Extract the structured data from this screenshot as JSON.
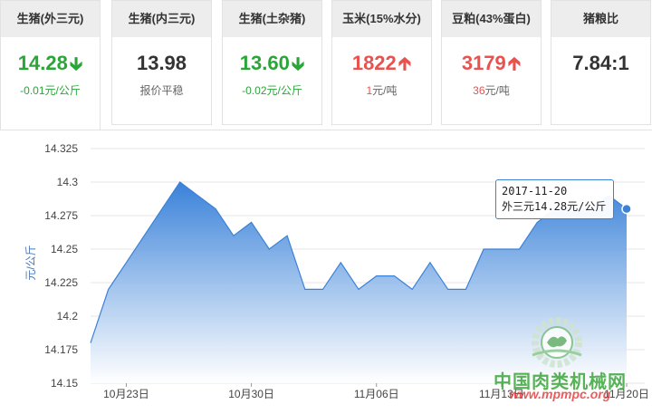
{
  "cards": [
    {
      "name": "生猪(外三元)",
      "value": "14.28",
      "trend": "down",
      "change": "-0.01元/公斤"
    },
    {
      "name": "生猪(内三元)",
      "value": "13.98",
      "trend": "none",
      "change": "报价平稳"
    },
    {
      "name": "生猪(土杂猪)",
      "value": "13.60",
      "trend": "down",
      "change": "-0.02元/公斤"
    },
    {
      "name": "玉米(15%水分)",
      "value": "1822",
      "trend": "up",
      "change_num": "1",
      "change_unit": "元/吨"
    },
    {
      "name": "豆粕(43%蛋白)",
      "value": "3179",
      "trend": "up",
      "change_num": "36",
      "change_unit": "元/吨"
    },
    {
      "name": "猪粮比",
      "value": "7.84:1",
      "trend": "none",
      "change": ""
    }
  ],
  "colors": {
    "up": "#e8524f",
    "down": "#2aa639",
    "line": "#3b82d6",
    "fill_top": "#2f7bd7",
    "fill_bottom": "#ffffff"
  },
  "tooltip": {
    "date": "2017-11-20",
    "label": "外三元14.28元/公斤"
  },
  "watermark": {
    "text": "中国肉类机械网",
    "url": "www.mpmpc.org",
    "logo": "gear-logo"
  },
  "chart_data": {
    "type": "area",
    "ylabel": "元/公斤",
    "ylim": [
      14.15,
      14.325
    ],
    "yticks": [
      "14.325",
      "14.3",
      "14.275",
      "14.25",
      "14.225",
      "14.2",
      "14.175",
      "14.15"
    ],
    "xlabels": [
      "10月23日",
      "10月30日",
      "11月06日",
      "11月13日",
      "11月20日"
    ],
    "grid": true,
    "series": [
      {
        "name": "外三元",
        "x": [
          "2017-10-21",
          "2017-10-22",
          "2017-10-23",
          "2017-10-24",
          "2017-10-25",
          "2017-10-26",
          "2017-10-27",
          "2017-10-28",
          "2017-10-29",
          "2017-10-30",
          "2017-10-31",
          "2017-11-01",
          "2017-11-02",
          "2017-11-03",
          "2017-11-04",
          "2017-11-05",
          "2017-11-06",
          "2017-11-07",
          "2017-11-08",
          "2017-11-09",
          "2017-11-10",
          "2017-11-11",
          "2017-11-12",
          "2017-11-13",
          "2017-11-14",
          "2017-11-15",
          "2017-11-16",
          "2017-11-17",
          "2017-11-18",
          "2017-11-19",
          "2017-11-20"
        ],
        "values": [
          14.18,
          14.22,
          14.24,
          14.26,
          14.28,
          14.3,
          14.29,
          14.28,
          14.26,
          14.27,
          14.25,
          14.26,
          14.22,
          14.22,
          14.24,
          14.22,
          14.23,
          14.23,
          14.22,
          14.24,
          14.22,
          14.22,
          14.25,
          14.25,
          14.25,
          14.27,
          14.28,
          14.28,
          14.28,
          14.29,
          14.28
        ]
      }
    ]
  }
}
